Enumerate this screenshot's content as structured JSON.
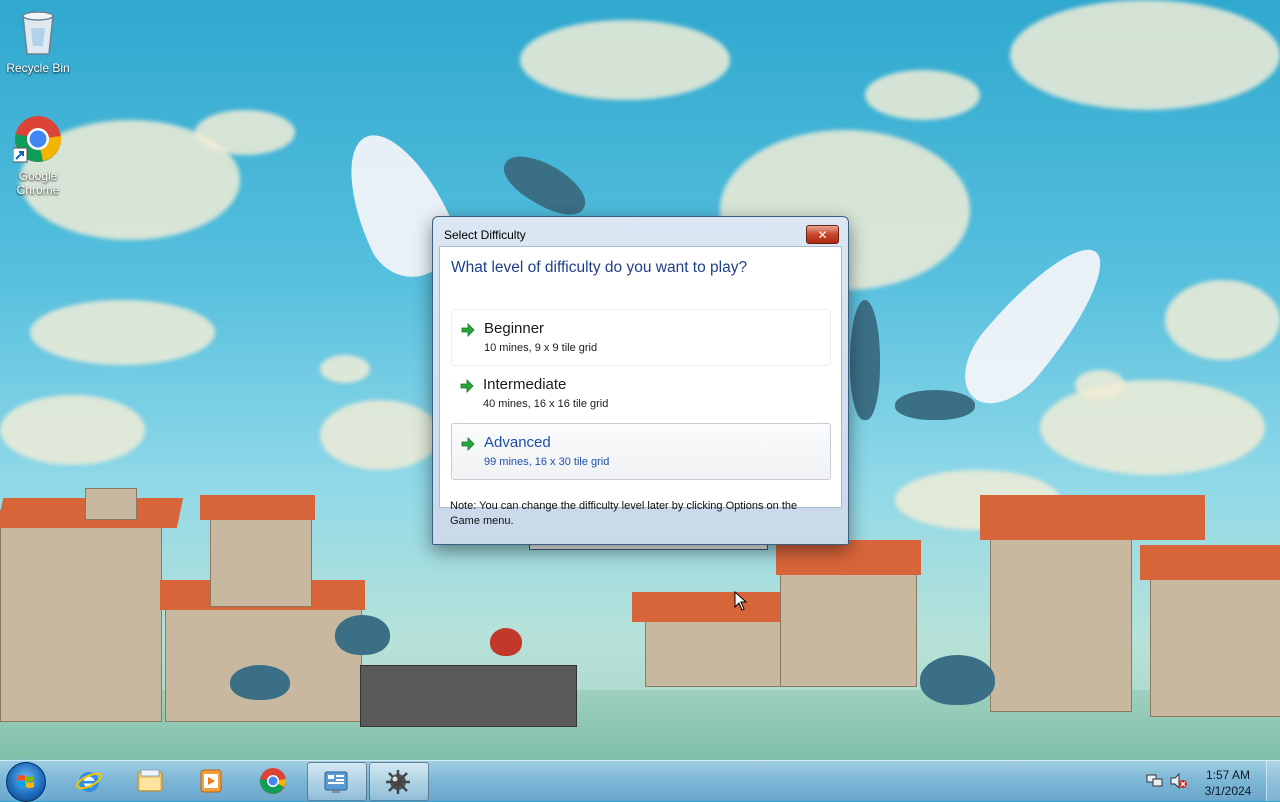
{
  "desktop": {
    "icons": [
      {
        "label": "Recycle Bin",
        "icon": "recycle-bin-icon"
      },
      {
        "label": "Google Chrome",
        "icon": "chrome-icon"
      }
    ]
  },
  "dialog": {
    "title": "Select Difficulty",
    "close_label": "✕",
    "question": "What level of difficulty do you want to play?",
    "options": [
      {
        "name": "Beginner",
        "description": "10 mines, 9 x 9 tile grid"
      },
      {
        "name": "Intermediate",
        "description": "40 mines, 16 x 16 tile grid"
      },
      {
        "name": "Advanced",
        "description": "99 mines, 16 x 30 tile grid"
      }
    ],
    "note": "Note: You can change the difficulty level later by clicking Options on the Game menu."
  },
  "taskbar": {
    "pinned": [
      "internet-explorer-icon",
      "windows-explorer-icon",
      "media-player-icon",
      "chrome-icon",
      "control-panel-icon",
      "minesweeper-icon"
    ],
    "clock": {
      "time": "1:57 AM",
      "date": "3/1/2024"
    }
  },
  "colors": {
    "accent": "#1e50a8",
    "question": "#1e3f8a",
    "arrow": "#2aa63a"
  }
}
